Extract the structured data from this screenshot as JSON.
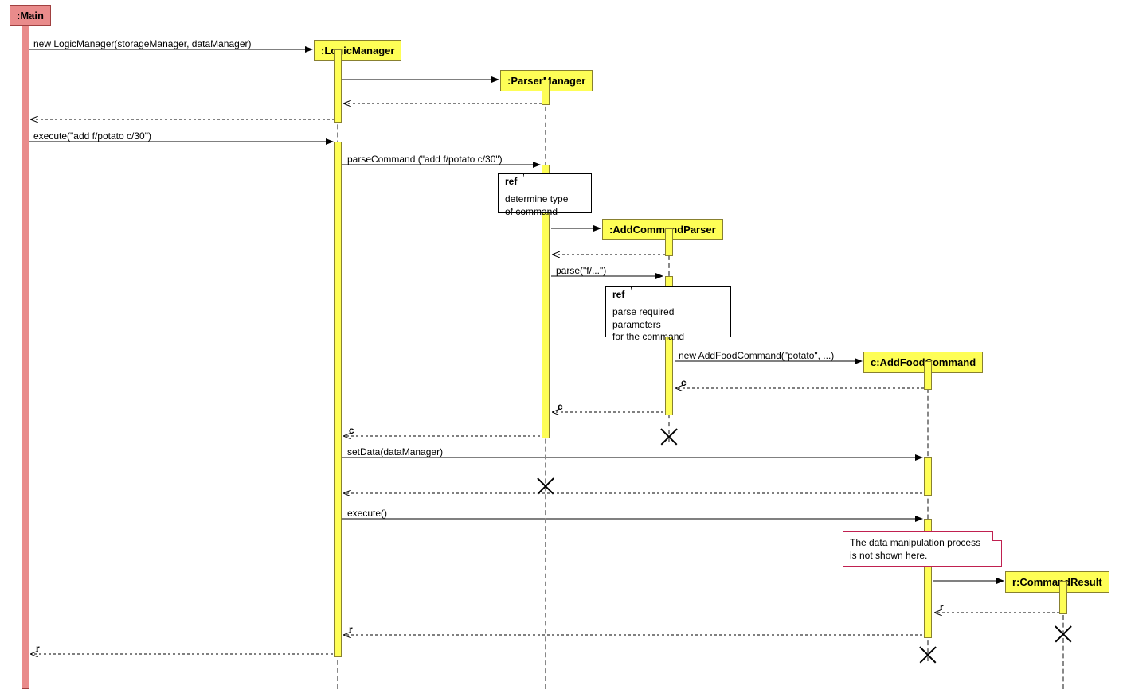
{
  "participants": {
    "main": ":Main",
    "logic": ":LogicManager",
    "parser": ":ParserManager",
    "addparser": ":AddCommandParser",
    "addfood": "c:AddFoodCommand",
    "result": "r:CommandResult"
  },
  "messages": {
    "m1": "new LogicManager(storageManager, dataManager)",
    "m2": "execute(\"add f/potato c/30\")",
    "m3": "parseCommand (\"add f/potato c/30\")",
    "m4": "parse(\"f/...\")",
    "m5": "new AddFoodCommand(\"potato\", ...)",
    "m6": "c",
    "m7": "c",
    "m8": "c",
    "m9": "setData(dataManager)",
    "m10": "execute()",
    "m11": "r",
    "m12": "r",
    "m13": "r"
  },
  "refs": {
    "r1": "determine type\nof command",
    "r2": "parse required\nparameters\nfor the command"
  },
  "notes": {
    "n1": "The data manipulation process\nis not shown here."
  },
  "ref_label": "ref"
}
